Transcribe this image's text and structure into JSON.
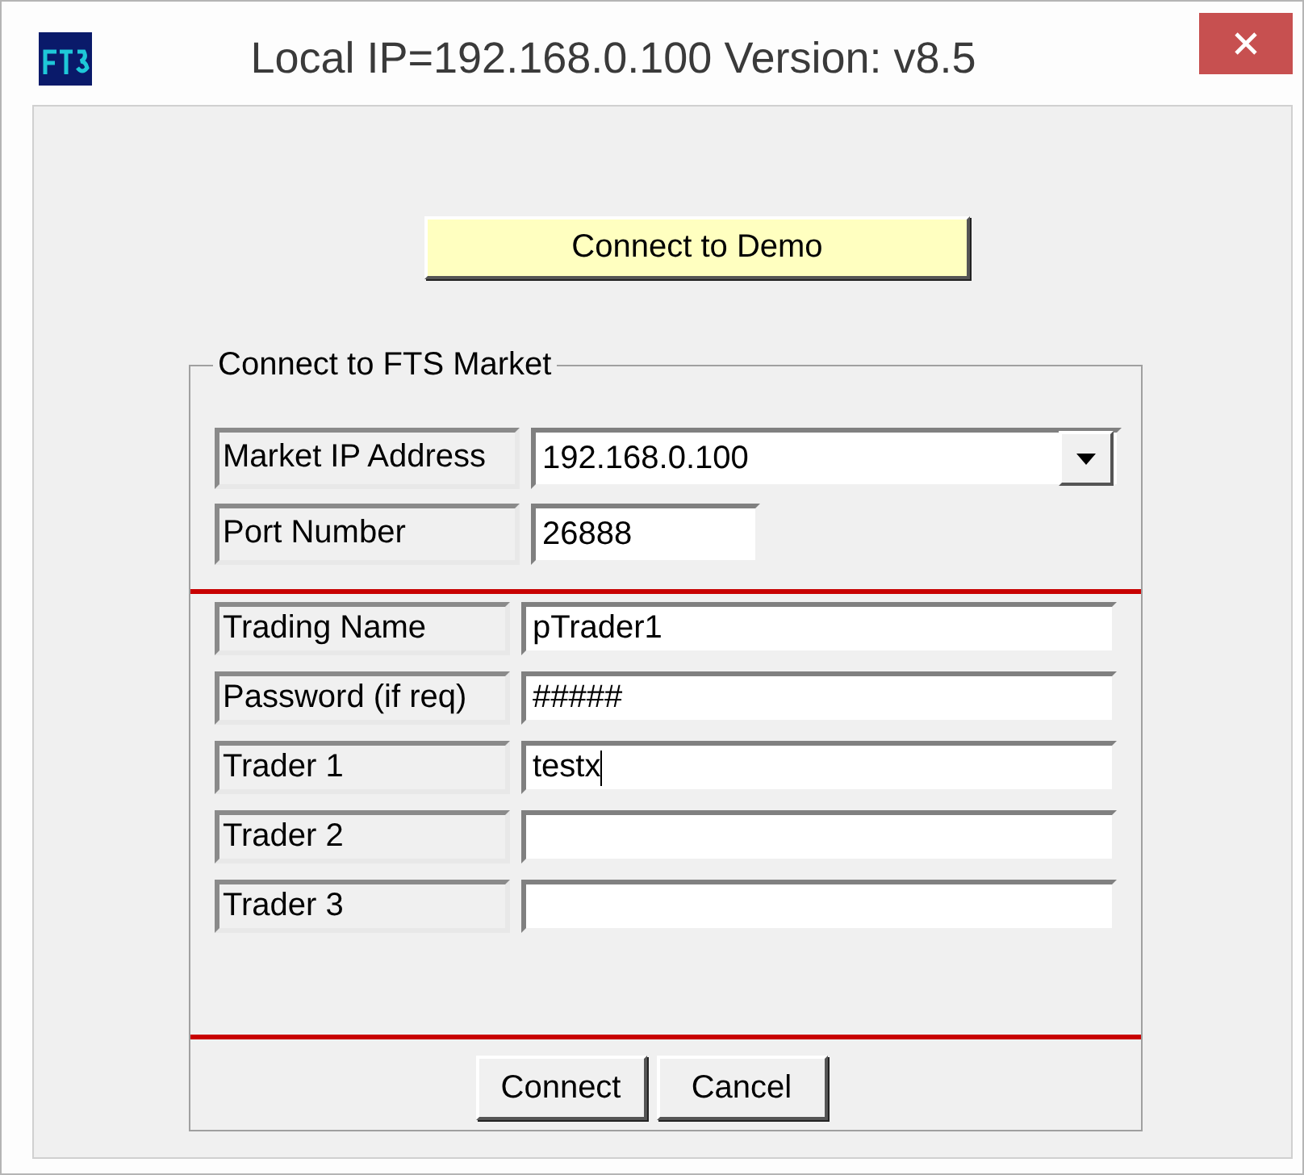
{
  "window": {
    "title": "Local IP=192.168.0.100 Version: v8.5"
  },
  "demo_button": "Connect to Demo",
  "group": {
    "title": "Connect to FTS Market",
    "server_fields": [
      {
        "label": "Market IP Address",
        "value": "192.168.0.100",
        "kind": "dropdown"
      },
      {
        "label": "Port Number",
        "value": "26888",
        "kind": "short"
      }
    ],
    "trader_fields": [
      {
        "label": "Trading Name",
        "value": "pTrader1",
        "focused": false
      },
      {
        "label": "Password (if req)",
        "value": "#####",
        "focused": false
      },
      {
        "label": "Trader 1",
        "value": "testx",
        "focused": true
      },
      {
        "label": "Trader 2",
        "focused": false
      },
      {
        "label": "Trader 3",
        "focused": false
      }
    ],
    "buttons": [
      "Connect",
      "Cancel"
    ]
  }
}
